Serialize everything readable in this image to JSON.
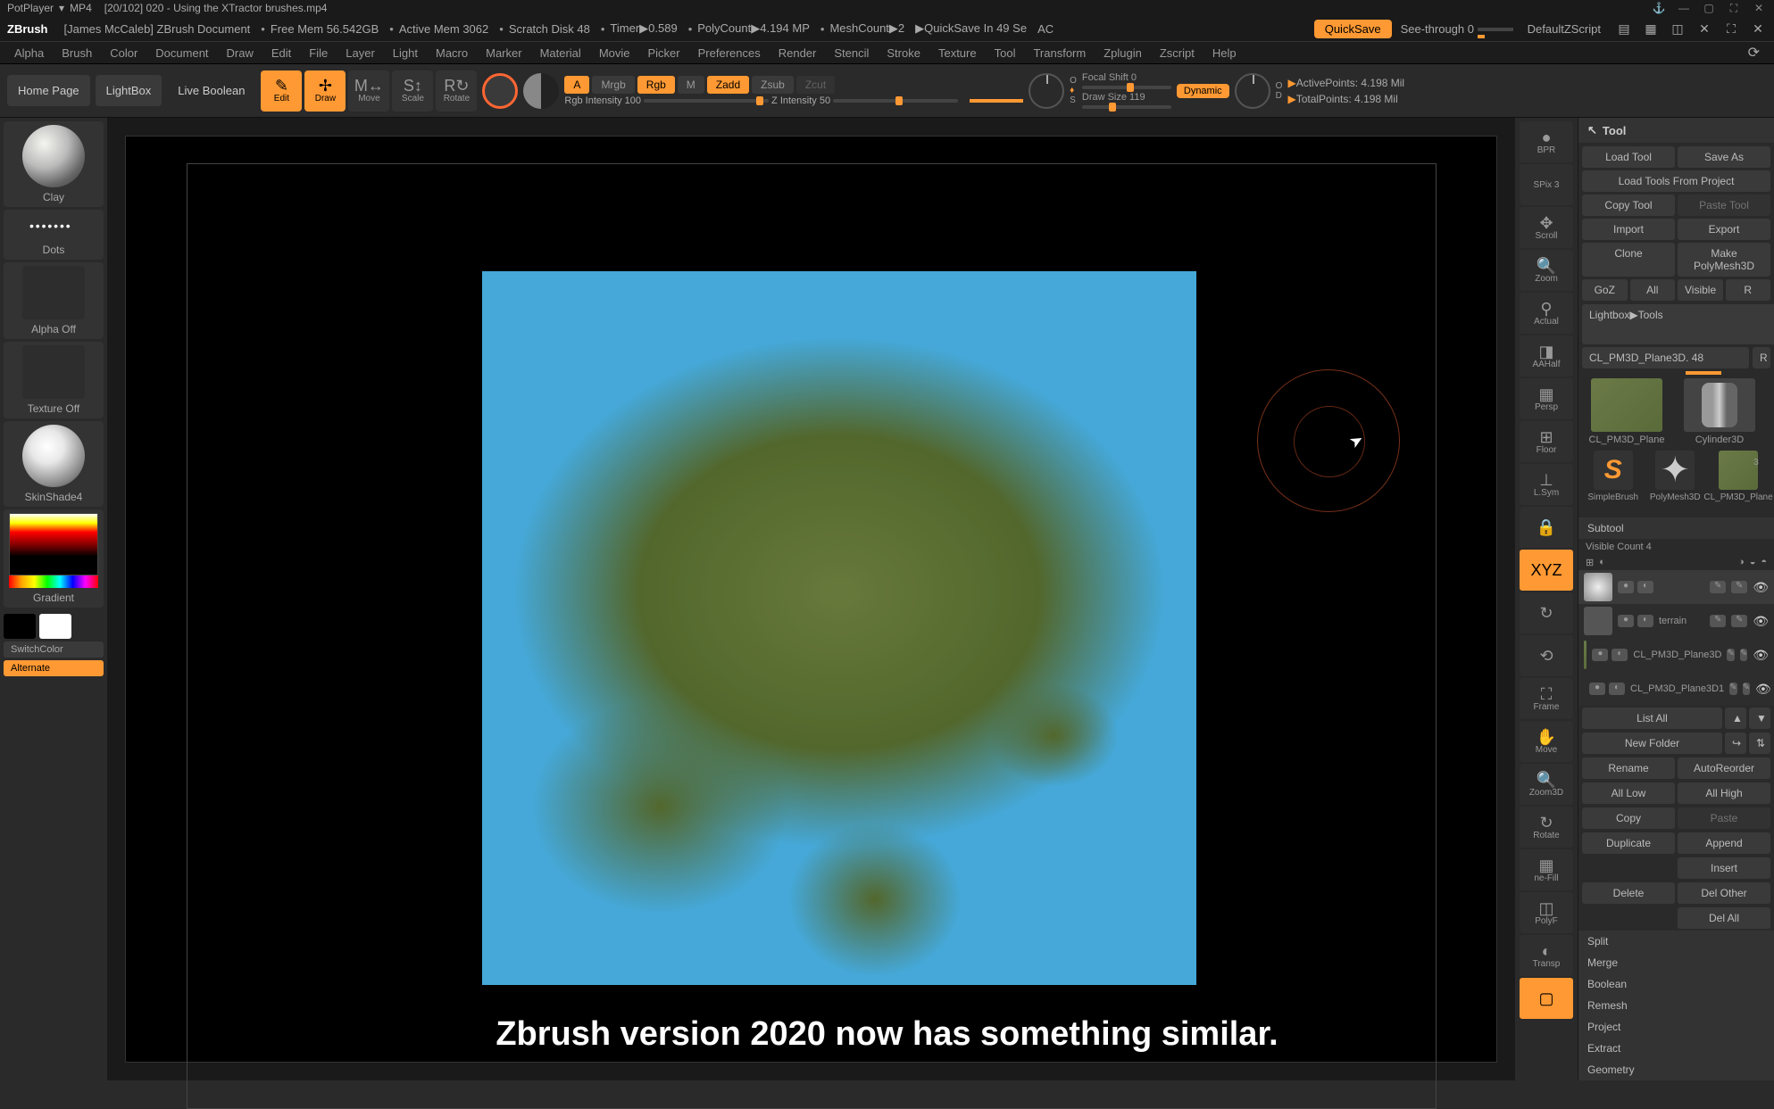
{
  "titlebar": {
    "app": "PotPlayer",
    "format": "MP4",
    "file": "[20/102] 020 - Using the XTractor brushes.mp4"
  },
  "zbrush_top": {
    "app": "ZBrush",
    "doc": "[James McCaleb]  ZBrush Document",
    "free_mem": "Free Mem 56.542GB",
    "active_mem": "Active Mem 3062",
    "scratch": "Scratch Disk 48",
    "timer": "Timer▶0.589",
    "polycount": "PolyCount▶4.194 MP",
    "meshcount": "MeshCount▶2",
    "quicksave_in": "▶QuickSave In 49 Se",
    "ac": "AC",
    "quicksave": "QuickSave",
    "seethrough": "See-through  0",
    "default_script": "DefaultZScript"
  },
  "menu": [
    "Alpha",
    "Brush",
    "Color",
    "Document",
    "Draw",
    "Edit",
    "File",
    "Layer",
    "Light",
    "Macro",
    "Marker",
    "Material",
    "Movie",
    "Picker",
    "Preferences",
    "Render",
    "Stencil",
    "Stroke",
    "Texture",
    "Tool",
    "Transform",
    "Zplugin",
    "Zscript",
    "Help"
  ],
  "shelf": {
    "home": "Home Page",
    "lightbox": "LightBox",
    "liveboolean": "Live Boolean",
    "tools": [
      {
        "label": "Edit",
        "icon": "✎",
        "active": true
      },
      {
        "label": "Draw",
        "icon": "✢",
        "active": true
      },
      {
        "label": "Move",
        "icon": "M",
        "active": false
      },
      {
        "label": "Scale",
        "icon": "S",
        "active": false
      },
      {
        "label": "Rotate",
        "icon": "R",
        "active": false
      }
    ],
    "mode": {
      "a": "A",
      "mrgb": "Mrgb",
      "rgb": "Rgb",
      "m": "M",
      "zadd": "Zadd",
      "zsub": "Zsub",
      "zcut": "Zcut",
      "rgb_intensity": "Rgb Intensity 100",
      "z_intensity": "Z Intensity 50"
    },
    "draw": {
      "focal": "Focal Shift 0",
      "drawsize": "Draw Size 119",
      "dynamic": "Dynamic"
    },
    "stats": {
      "active": "ActivePoints: 4.198 Mil",
      "total": "TotalPoints: 4.198 Mil"
    }
  },
  "left": {
    "brush": "Clay",
    "stroke": "Dots",
    "alpha": "Alpha Off",
    "texture": "Texture Off",
    "material": "SkinShade4",
    "gradient": "Gradient",
    "switchcolor": "SwitchColor",
    "alternate": "Alternate"
  },
  "rail": [
    {
      "icon": "●",
      "label": "BPR"
    },
    {
      "icon": "",
      "label": "SPix 3"
    },
    {
      "icon": "✥",
      "label": "Scroll"
    },
    {
      "icon": "🔍",
      "label": "Zoom"
    },
    {
      "icon": "⚲",
      "label": "Actual"
    },
    {
      "icon": "◨",
      "label": "AAHalf"
    },
    {
      "icon": "▦",
      "label": "Persp"
    },
    {
      "icon": "⊞",
      "label": "Floor"
    },
    {
      "icon": "⊥",
      "label": "L.Sym"
    },
    {
      "icon": "🔒",
      "label": ""
    },
    {
      "icon": "XYZ",
      "label": "",
      "orange": true
    },
    {
      "icon": "↻",
      "label": ""
    },
    {
      "icon": "⟲",
      "label": ""
    },
    {
      "icon": "⛶",
      "label": "Frame"
    },
    {
      "icon": "✋",
      "label": "Move"
    },
    {
      "icon": "🔍",
      "label": "Zoom3D"
    },
    {
      "icon": "↻",
      "label": "Rotate"
    },
    {
      "icon": "▦",
      "label": "ne-Fill"
    },
    {
      "icon": "◫",
      "label": "PolyF"
    },
    {
      "icon": "◐",
      "label": "Transp"
    },
    {
      "icon": "▢",
      "label": "",
      "orange": true
    }
  ],
  "tool": {
    "header": "Tool",
    "btns_top": [
      [
        "Load Tool",
        "Save As"
      ],
      [
        "Load Tools From Project",
        ""
      ],
      [
        "Copy Tool",
        "Paste Tool"
      ],
      [
        "Import",
        "Export"
      ],
      [
        "Clone",
        "Make PolyMesh3D"
      ],
      [
        "GoZ",
        "All",
        "Visible",
        "R"
      ]
    ],
    "lightbox_tools": "Lightbox▶Tools",
    "current": "CL_PM3D_Plane3D. 48",
    "r_btn": "R",
    "thumbs": [
      {
        "label": "CL_PM3D_Plane",
        "type": "terrain"
      },
      {
        "label": "Cylinder3D",
        "type": "cyl"
      },
      {
        "label": "SimpleBrush",
        "type": "s"
      },
      {
        "label": "PolyMesh3D",
        "type": "star"
      },
      {
        "label": "CL_PM3D_Plane",
        "type": "terrain"
      }
    ],
    "subtool": {
      "header": "Subtool",
      "visible": "Visible Count 4",
      "items": [
        {
          "name": "",
          "sel": true
        },
        {
          "name": "terrain"
        },
        {
          "name": "CL_PM3D_Plane3D"
        },
        {
          "name": "CL_PM3D_Plane3D1"
        }
      ],
      "listall": "List All",
      "newfolder": "New Folder",
      "actions": [
        [
          "Rename",
          "AutoReorder"
        ],
        [
          "All Low",
          "All High"
        ],
        [
          "Copy",
          "Paste"
        ],
        [
          "Duplicate",
          "Append"
        ],
        [
          "",
          "Insert"
        ],
        [
          "Delete",
          "Del Other"
        ],
        [
          "",
          "Del All"
        ]
      ],
      "sections": [
        "Split",
        "Merge",
        "Boolean",
        "Remesh",
        "Project",
        "Extract"
      ],
      "geometry": "Geometry"
    }
  },
  "subtitle": "Zbrush version 2020 now has something similar."
}
